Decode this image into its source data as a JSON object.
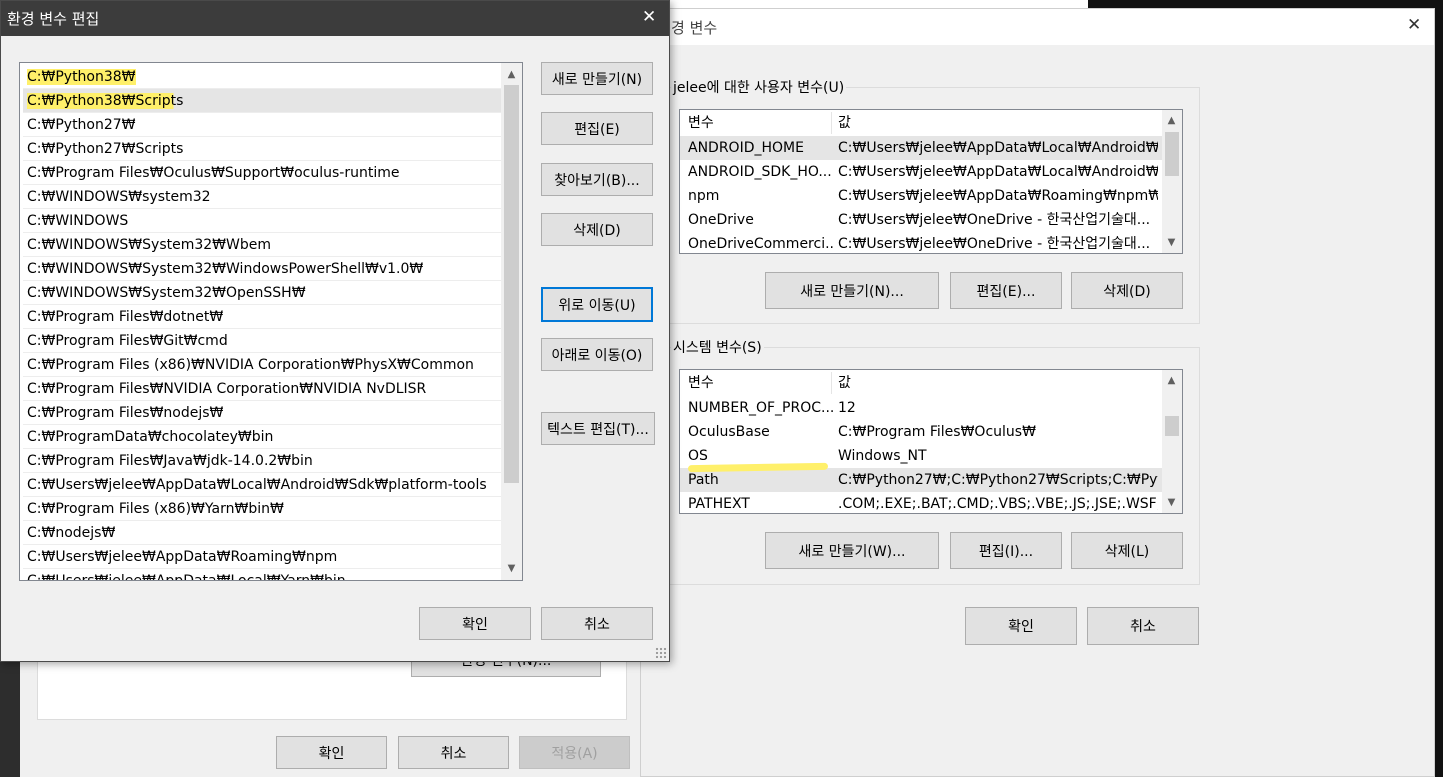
{
  "bg_dialog": {
    "title": "경 변수",
    "close_glyph": "✕",
    "user_group_title": "jelee에 대한 사용자 변수(U)",
    "system_group_title": "시스템 변수(S)",
    "columns": {
      "name": "변수",
      "value": "값"
    },
    "user_vars": [
      {
        "name": "ANDROID_HOME",
        "value": "C:₩Users₩jelee₩AppData₩Local₩Android₩S..."
      },
      {
        "name": "ANDROID_SDK_HO...",
        "value": "C:₩Users₩jelee₩AppData₩Local₩Android₩S..."
      },
      {
        "name": "npm",
        "value": "C:₩Users₩jelee₩AppData₩Roaming₩npm₩n..."
      },
      {
        "name": "OneDrive",
        "value": "C:₩Users₩jelee₩OneDrive - 한국산업기술대..."
      },
      {
        "name": "OneDriveCommerci...",
        "value": "C:₩Users₩jelee₩OneDrive - 한국산업기술대..."
      }
    ],
    "user_buttons": {
      "new": "새로 만들기(N)...",
      "edit": "편집(E)...",
      "delete": "삭제(D)"
    },
    "system_vars": [
      {
        "name": "NUMBER_OF_PROC...",
        "value": "12"
      },
      {
        "name": "OculusBase",
        "value": "C:₩Program Files₩Oculus₩"
      },
      {
        "name": "OS",
        "value": "Windows_NT"
      },
      {
        "name": "Path",
        "value": "C:₩Python27₩;C:₩Python27₩Scripts;C:₩Pyth..."
      },
      {
        "name": "PATHEXT",
        "value": ".COM;.EXE;.BAT;.CMD;.VBS;.VBE;.JS;.JSE;.WSF;..."
      }
    ],
    "system_buttons": {
      "new": "새로 만들기(W)...",
      "edit": "편집(I)...",
      "delete": "삭제(L)"
    },
    "ok": "확인",
    "cancel": "취소"
  },
  "back_dialog": {
    "env_button": "환경 변수(N)...",
    "ok": "확인",
    "cancel": "취소",
    "apply": "적용(A)"
  },
  "edit_dialog": {
    "title": "환경 변수 편집",
    "close_glyph": "✕",
    "path_entries": [
      "C:₩Python38₩",
      "C:₩Python38₩Scripts",
      "C:₩Python27₩",
      "C:₩Python27₩Scripts",
      "C:₩Program Files₩Oculus₩Support₩oculus-runtime",
      "C:₩WINDOWS₩system32",
      "C:₩WINDOWS",
      "C:₩WINDOWS₩System32₩Wbem",
      "C:₩WINDOWS₩System32₩WindowsPowerShell₩v1.0₩",
      "C:₩WINDOWS₩System32₩OpenSSH₩",
      "C:₩Program Files₩dotnet₩",
      "C:₩Program Files₩Git₩cmd",
      "C:₩Program Files (x86)₩NVIDIA Corporation₩PhysX₩Common",
      "C:₩Program Files₩NVIDIA Corporation₩NVIDIA NvDLISR",
      "C:₩Program Files₩nodejs₩",
      "C:₩ProgramData₩chocolatey₩bin",
      "C:₩Program Files₩Java₩jdk-14.0.2₩bin",
      "C:₩Users₩jelee₩AppData₩Local₩Android₩Sdk₩platform-tools",
      "C:₩Program Files (x86)₩Yarn₩bin₩",
      "C:₩nodejs₩",
      "C:₩Users₩jelee₩AppData₩Roaming₩npm",
      "C:₩Users₩jelee₩AppData₩Local₩Yarn₩bin"
    ],
    "buttons": {
      "new": "새로 만들기(N)",
      "edit": "편집(E)",
      "browse": "찾아보기(B)...",
      "delete": "삭제(D)",
      "move_up": "위로 이동(U)",
      "move_down": "아래로 이동(O)",
      "edit_text": "텍스트 편집(T)..."
    },
    "ok": "확인",
    "cancel": "취소"
  },
  "colors": {
    "highlighter": "#fff06a",
    "focus_blue": "#0078d7",
    "dialog_face": "#f0f0f0",
    "title_bar": "#3c3c3c"
  }
}
